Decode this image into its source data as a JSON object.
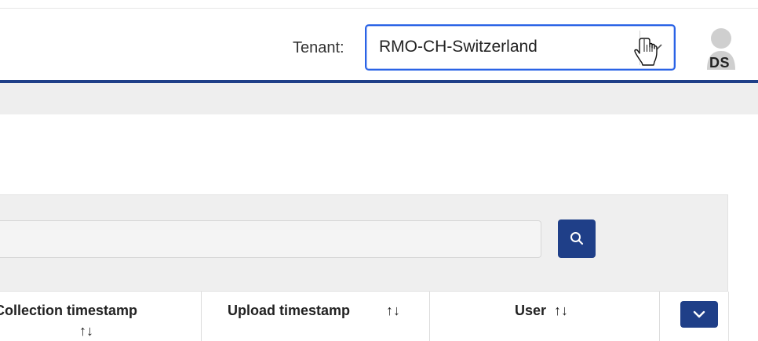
{
  "header": {
    "tenant_label": "Tenant:",
    "tenant_value": "RMO-CH-Switzerland",
    "user_initials": "DS"
  },
  "table": {
    "columns": [
      {
        "label": "Collection timestamp",
        "sort_icon": "↑↓"
      },
      {
        "label": "Upload timestamp",
        "sort_icon": "↑↓"
      },
      {
        "label": "User",
        "sort_icon": "↑↓"
      }
    ]
  },
  "colors": {
    "primary": "#1f3f88",
    "focus_border": "#2a63e6",
    "panel_bg": "#efefef"
  },
  "icons": {
    "search": "search-icon",
    "dropdown": "chevron-down-icon",
    "avatar": "user-avatar-icon",
    "cursor": "hand-cursor-icon"
  }
}
